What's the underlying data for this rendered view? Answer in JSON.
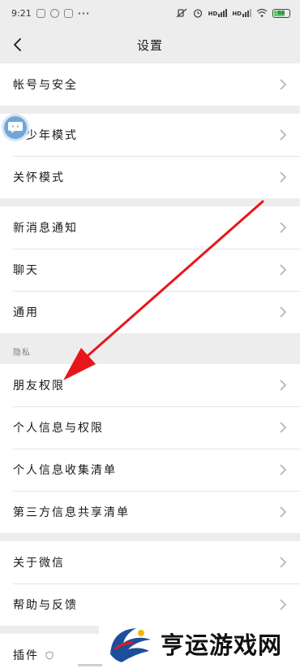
{
  "status_bar": {
    "time": "9:21",
    "dots": "···",
    "hd1": "HD",
    "hd2": "HD",
    "battery": "66",
    "icons": [
      "app-icon-1",
      "app-icon-2",
      "app-icon-3",
      "mute-icon",
      "alarm-icon",
      "signal-icon",
      "wifi-icon",
      "battery-icon"
    ]
  },
  "nav": {
    "title": "设置",
    "back_icon": "back-arrow-icon"
  },
  "groups": {
    "account": {
      "items": [
        {
          "label": "帐号与安全"
        }
      ]
    },
    "modes": {
      "items": [
        {
          "label": "青少年模式"
        },
        {
          "label": "关怀模式"
        }
      ]
    },
    "general": {
      "items": [
        {
          "label": "新消息通知"
        },
        {
          "label": "聊天"
        },
        {
          "label": "通用"
        }
      ]
    },
    "privacy": {
      "section_label": "隐私",
      "items": [
        {
          "label": "朋友权限"
        },
        {
          "label": "个人信息与权限"
        },
        {
          "label": "个人信息收集清单"
        },
        {
          "label": "第三方信息共享清单"
        }
      ]
    },
    "about": {
      "items": [
        {
          "label": "关于微信"
        },
        {
          "label": "帮助与反馈"
        }
      ]
    },
    "plugins": {
      "items": [
        {
          "label": "插件"
        }
      ]
    }
  },
  "watermark": {
    "text": "亨运游戏网"
  },
  "colors": {
    "background": "#ededed",
    "row_background": "#ffffff",
    "arrow": "#e8161b",
    "bubble": "#6fa8d8"
  }
}
